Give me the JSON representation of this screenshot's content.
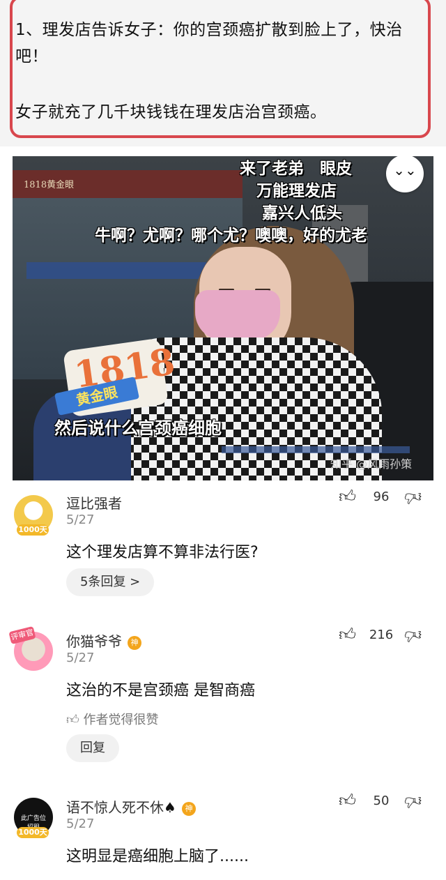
{
  "post": {
    "line1": "1、理发店告诉女子：你的宫颈癌扩散到脸上了，快治吧！",
    "line2": "女子就充了几千块钱钱在理发店治宫颈癌。"
  },
  "video": {
    "store_sign": "1818黄金眼",
    "caption_lines": [
      "来了老弟　眼皮",
      "万能理发店",
      "嘉兴人低头",
      "牛啊？尤啊？哪个尤？噢噢，好的尤老"
    ],
    "subtitle": "然后说什么宫颈癌细胞",
    "watermark": "知乎 @风雨孙策",
    "mic_number": "1818",
    "mic_name": "黄金眼",
    "collapse_glyph": "⌄⌄"
  },
  "comments": [
    {
      "username": "逗比强者",
      "date": "5/27",
      "text": "这个理发店算不算非法行医?",
      "likes": "96",
      "avatar_badge": "1000天",
      "reply_label": "5条回复 >"
    },
    {
      "username": "你猫爷爷",
      "badge": "神",
      "date": "5/27",
      "text": "这治的不是宫颈癌 是智商癌",
      "likes": "216",
      "avatar_tag": "评审官",
      "author_liked": "作者觉得很赞",
      "reply_label": "回复"
    },
    {
      "username": "语不惊人死不休",
      "suffix_icon": "♠",
      "badge": "神",
      "date": "5/27",
      "text": "这明显是癌细胞上脑了......",
      "likes": "50",
      "avatar_text": "此广告位招租",
      "avatar_badge": "1000天"
    }
  ],
  "icons": {
    "like": "thumbs-up-icon",
    "dislike": "thumbs-down-icon",
    "author_like": "small-thumbs-up-icon"
  },
  "colors": {
    "frame_red": "#d8474d",
    "badge_gold": "#f3a51c"
  }
}
